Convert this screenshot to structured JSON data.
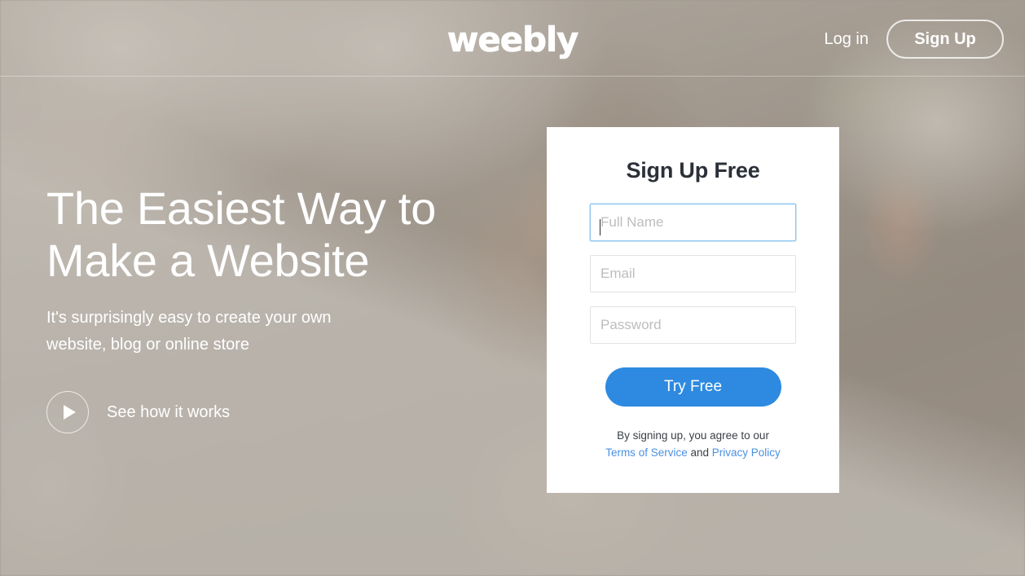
{
  "header": {
    "logo_text": "weebly",
    "login_label": "Log in",
    "signup_label": "Sign Up"
  },
  "hero": {
    "title": "The Easiest Way to\nMake a Website",
    "subtitle": "It's surprisingly easy to create your own\nwebsite, blog or online store",
    "video_label": "See how it works",
    "play_icon": "play-icon"
  },
  "signup_card": {
    "title": "Sign Up Free",
    "fields": [
      {
        "name": "full-name",
        "placeholder": "Full Name",
        "value": "",
        "focused": true
      },
      {
        "name": "email",
        "placeholder": "Email",
        "value": "",
        "focused": false
      },
      {
        "name": "password",
        "placeholder": "Password",
        "value": "",
        "focused": false
      }
    ],
    "submit_label": "Try Free",
    "legal_prefix": "By signing up, you agree to our",
    "terms_label": "Terms of Service",
    "legal_conjunction": "and",
    "privacy_label": "Privacy Policy"
  },
  "colors": {
    "accent_blue": "#2e8ae0",
    "link_blue": "#4a90e2",
    "focus_border": "#8ec7f0",
    "card_background": "#ffffff",
    "title_dark": "#2c3038",
    "overlay_warm_gray": "#8a827a"
  }
}
